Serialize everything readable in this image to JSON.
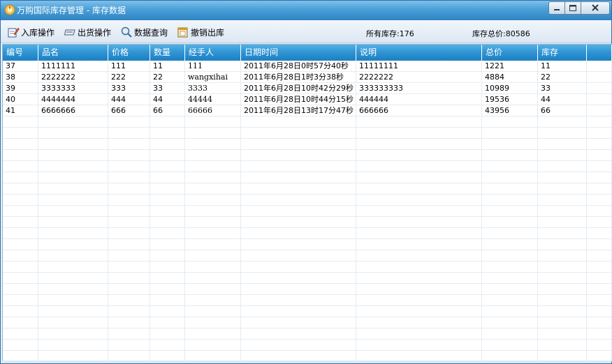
{
  "window": {
    "title": "万购国际库存管理 - 库存数据"
  },
  "toolbar": {
    "stock_in_label": "入库操作",
    "ship_label": "出货操作",
    "query_label": "数据查询",
    "cancel_out_label": "撤销出库",
    "total_stock_text": "所有库存:176",
    "total_value_text": "库存总价:80586"
  },
  "table": {
    "columns": [
      "编号",
      "品名",
      "价格",
      "数量",
      "经手人",
      "日期时间",
      "说明",
      "总价",
      "库存"
    ],
    "rows": [
      [
        "37",
        "1111111",
        "111",
        "11",
        "111",
        "2011年6月28日0时57分40秒",
        "11111111",
        "1221",
        "11"
      ],
      [
        "38",
        "2222222",
        "222",
        "22",
        "wangxihai",
        "2011年6月28日1时3分38秒",
        "2222222",
        "4884",
        "22"
      ],
      [
        "39",
        "3333333",
        "333",
        "33",
        "3333",
        "2011年6月28日10时42分29秒",
        "333333333",
        "10989",
        "33"
      ],
      [
        "40",
        "4444444",
        "444",
        "44",
        "44444",
        "2011年6月28日10时44分15秒",
        "444444",
        "19536",
        "44"
      ],
      [
        "41",
        "6666666",
        "666",
        "66",
        "66666",
        "2011年6月28日13时17分47秒",
        "666666",
        "43956",
        "66"
      ]
    ]
  }
}
